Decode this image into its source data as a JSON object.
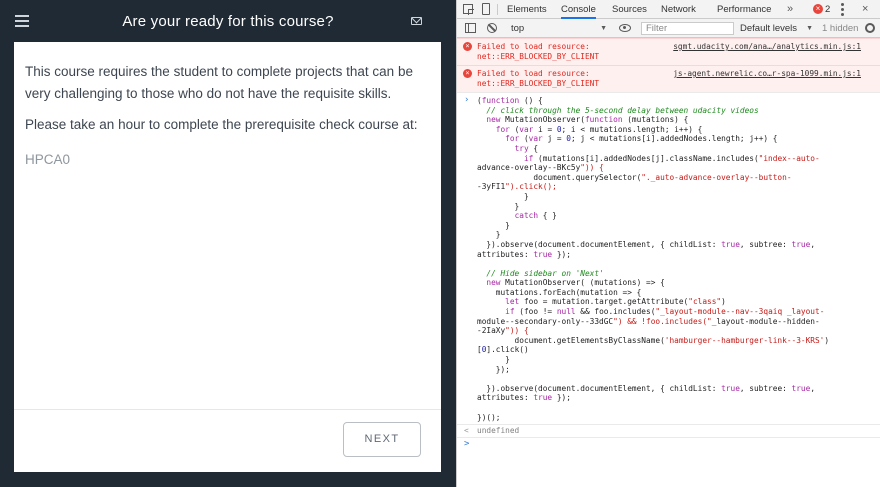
{
  "app": {
    "title": "Are your ready for this course?",
    "paragraph_1": "This course requires the student to complete projects that can be very challenging to those who do not have the requisite skills.",
    "paragraph_2": "Please take an hour to complete the prerequisite check course at:",
    "course_code": "HPCA0",
    "next_label": "NEXT"
  },
  "devtools": {
    "tabs": [
      "Elements",
      "Console",
      "Sources",
      "Network",
      "Performance"
    ],
    "active_tab": "Console",
    "more_label": "»",
    "error_badge": "×",
    "error_count": "2",
    "close_label": "×",
    "toolbar": {
      "context": "top",
      "filter_placeholder": "Filter",
      "levels": "Default levels",
      "hidden": "1 hidden"
    },
    "errors": [
      {
        "message": "Failed to load resource:\nnet::ERR_BLOCKED_BY_CLIENT",
        "source": "sgmt.udacity.com/ana…/analytics.min.js:1"
      },
      {
        "message": "Failed to load resource:\nnet::ERR_BLOCKED_BY_CLIENT",
        "source": "js-agent.newrelic.co…r-spa-1099.min.js:1"
      }
    ],
    "code_lines": [
      "(function () {",
      "  // click through the 5-second delay between udacity videos",
      "  new MutationObserver(function (mutations) {",
      "    for (var i = 0; i < mutations.length; i++) {",
      "      for (var j = 0; j < mutations[i].addedNodes.length; j++) {",
      "        try {",
      "          if (mutations[i].addedNodes[j].className.includes(\"index--auto-",
      "advance-overlay--BKc5y\")) {",
      "            document.querySelector(\"._auto-advance-overlay--button-",
      "-3yFI1\").click();",
      "          }",
      "        }",
      "        catch { }",
      "      }",
      "    }",
      "  }).observe(document.documentElement, { childList: true, subtree: true,",
      "attributes: true });",
      "",
      "  // Hide sidebar on 'Next'",
      "  new MutationObserver( (mutations) => {",
      "    mutations.forEach(mutation => {",
      "      let foo = mutation.target.getAttribute(\"class\")",
      "      if (foo != null && foo.includes(\"_layout-module--nav--3qaiq _layout-",
      "module--secondary-only--33dGC\") && !foo.includes(\"_layout-module--hidden-",
      "-2IaXy\")) {",
      "        document.getElementsByClassName('hamburger--hamburger-link--3-KRS')",
      "[0].click()",
      "      }",
      "    });",
      "",
      "  }).observe(document.documentElement, { childList: true, subtree: true,",
      "attributes: true });",
      "",
      "})();"
    ],
    "result": "undefined",
    "prompt_symbol": ">",
    "result_symbol": "<"
  }
}
